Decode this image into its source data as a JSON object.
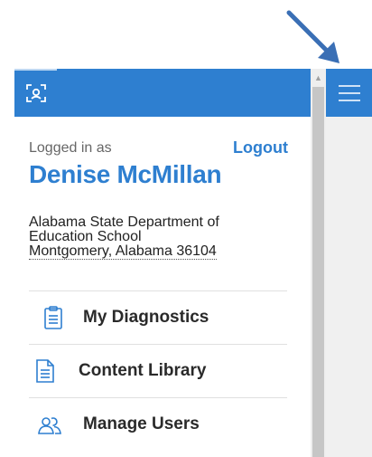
{
  "header": {
    "logo_icon": "scan-face-icon",
    "menu_icon": "hamburger-icon"
  },
  "account": {
    "logged_in_label": "Logged in as",
    "logout_label": "Logout",
    "user_name": "Denise McMillan",
    "org_lines": [
      "Alabama State Department of",
      "Education School",
      "Montgomery, Alabama 36104"
    ]
  },
  "nav": {
    "items": [
      {
        "label": "My Diagnostics",
        "icon": "clipboard-icon"
      },
      {
        "label": "Content Library",
        "icon": "document-icon"
      },
      {
        "label": "Manage Users",
        "icon": "users-icon"
      }
    ]
  },
  "colors": {
    "accent": "#2e7fd0",
    "annotation_arrow": "#3a6fb5"
  }
}
